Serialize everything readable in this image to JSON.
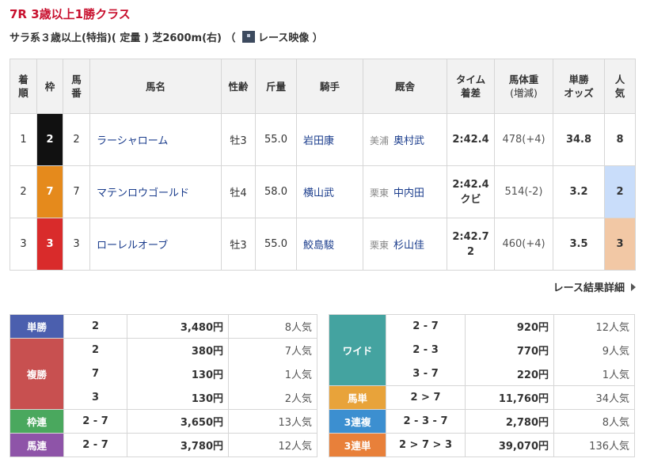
{
  "race": {
    "title": "7R 3歳以上1勝クラス",
    "conditions": "サラ系３歳以上(特指)( 定量 ) 芝2600m(右) （",
    "video_label": "レース映像",
    "close_paren": "）"
  },
  "results_table": {
    "headers": {
      "rank": [
        "着",
        "順"
      ],
      "frame": "枠",
      "number": [
        "馬",
        "番"
      ],
      "horse": "馬名",
      "sex_age": "性齢",
      "weight": "斤量",
      "jockey": "騎手",
      "trainer": "厩舎",
      "time": [
        "タイム",
        "着差"
      ],
      "body_weight": [
        "馬体重",
        "(増減)"
      ],
      "odds": [
        "単勝",
        "オッズ"
      ],
      "popularity": [
        "人",
        "気"
      ]
    },
    "rows": [
      {
        "rank": "1",
        "frame": "2",
        "number": "2",
        "horse": "ラーシャローム",
        "sex_age": "牡3",
        "weight": "55.0",
        "jockey": "岩田康",
        "region": "美浦",
        "trainer": "奥村武",
        "time": "2:42.4",
        "margin": "",
        "body_weight": "478(+4)",
        "odds": "34.8",
        "popularity": "8"
      },
      {
        "rank": "2",
        "frame": "7",
        "number": "7",
        "horse": "マテンロウゴールド",
        "sex_age": "牡4",
        "weight": "58.0",
        "jockey": "横山武",
        "region": "栗東",
        "trainer": "中内田",
        "time": "2:42.4",
        "margin": "クビ",
        "body_weight": "514(-2)",
        "odds": "3.2",
        "popularity": "2"
      },
      {
        "rank": "3",
        "frame": "3",
        "number": "3",
        "horse": "ローレルオーブ",
        "sex_age": "牡3",
        "weight": "55.0",
        "jockey": "鮫島駿",
        "region": "栗東",
        "trainer": "杉山佳",
        "time": "2:42.7",
        "margin": "2",
        "body_weight": "460(+4)",
        "odds": "3.5",
        "popularity": "3"
      }
    ]
  },
  "detail_link": "レース結果詳細",
  "payouts_left": {
    "tansho": {
      "label": "単勝",
      "rows": [
        {
          "combo": "2",
          "amount": "3,480円",
          "pop": "8人気"
        }
      ]
    },
    "fukusho": {
      "label": "複勝",
      "rows": [
        {
          "combo": "2",
          "amount": "380円",
          "pop": "7人気"
        },
        {
          "combo": "7",
          "amount": "130円",
          "pop": "1人気"
        },
        {
          "combo": "3",
          "amount": "130円",
          "pop": "2人気"
        }
      ]
    },
    "wakuren": {
      "label": "枠連",
      "rows": [
        {
          "combo": "2 - 7",
          "amount": "3,650円",
          "pop": "13人気"
        }
      ]
    },
    "umaren": {
      "label": "馬連",
      "rows": [
        {
          "combo": "2 - 7",
          "amount": "3,780円",
          "pop": "12人気"
        }
      ]
    }
  },
  "payouts_right": {
    "wide": {
      "label": "ワイド",
      "rows": [
        {
          "combo": "2 - 7",
          "amount": "920円",
          "pop": "12人気"
        },
        {
          "combo": "2 - 3",
          "amount": "770円",
          "pop": "9人気"
        },
        {
          "combo": "3 - 7",
          "amount": "220円",
          "pop": "1人気"
        }
      ]
    },
    "umatan": {
      "label": "馬単",
      "rows": [
        {
          "combo": "2 > 7",
          "amount": "11,760円",
          "pop": "34人気"
        }
      ]
    },
    "sanrenpuku": {
      "label": "3連複",
      "rows": [
        {
          "combo": "2 - 3 - 7",
          "amount": "2,780円",
          "pop": "8人気"
        }
      ]
    },
    "sanrentan": {
      "label": "3連単",
      "rows": [
        {
          "combo": "2 > 7 > 3",
          "amount": "39,070円",
          "pop": "136人気"
        }
      ]
    }
  },
  "colors": {
    "title_red": "#c8102e",
    "frame_2": "#111111",
    "frame_7": "#e58a1c",
    "frame_3": "#d92b2b",
    "popular_1_bg": "#c9ddfa",
    "popular_2_bg": "#f2c8a5"
  }
}
